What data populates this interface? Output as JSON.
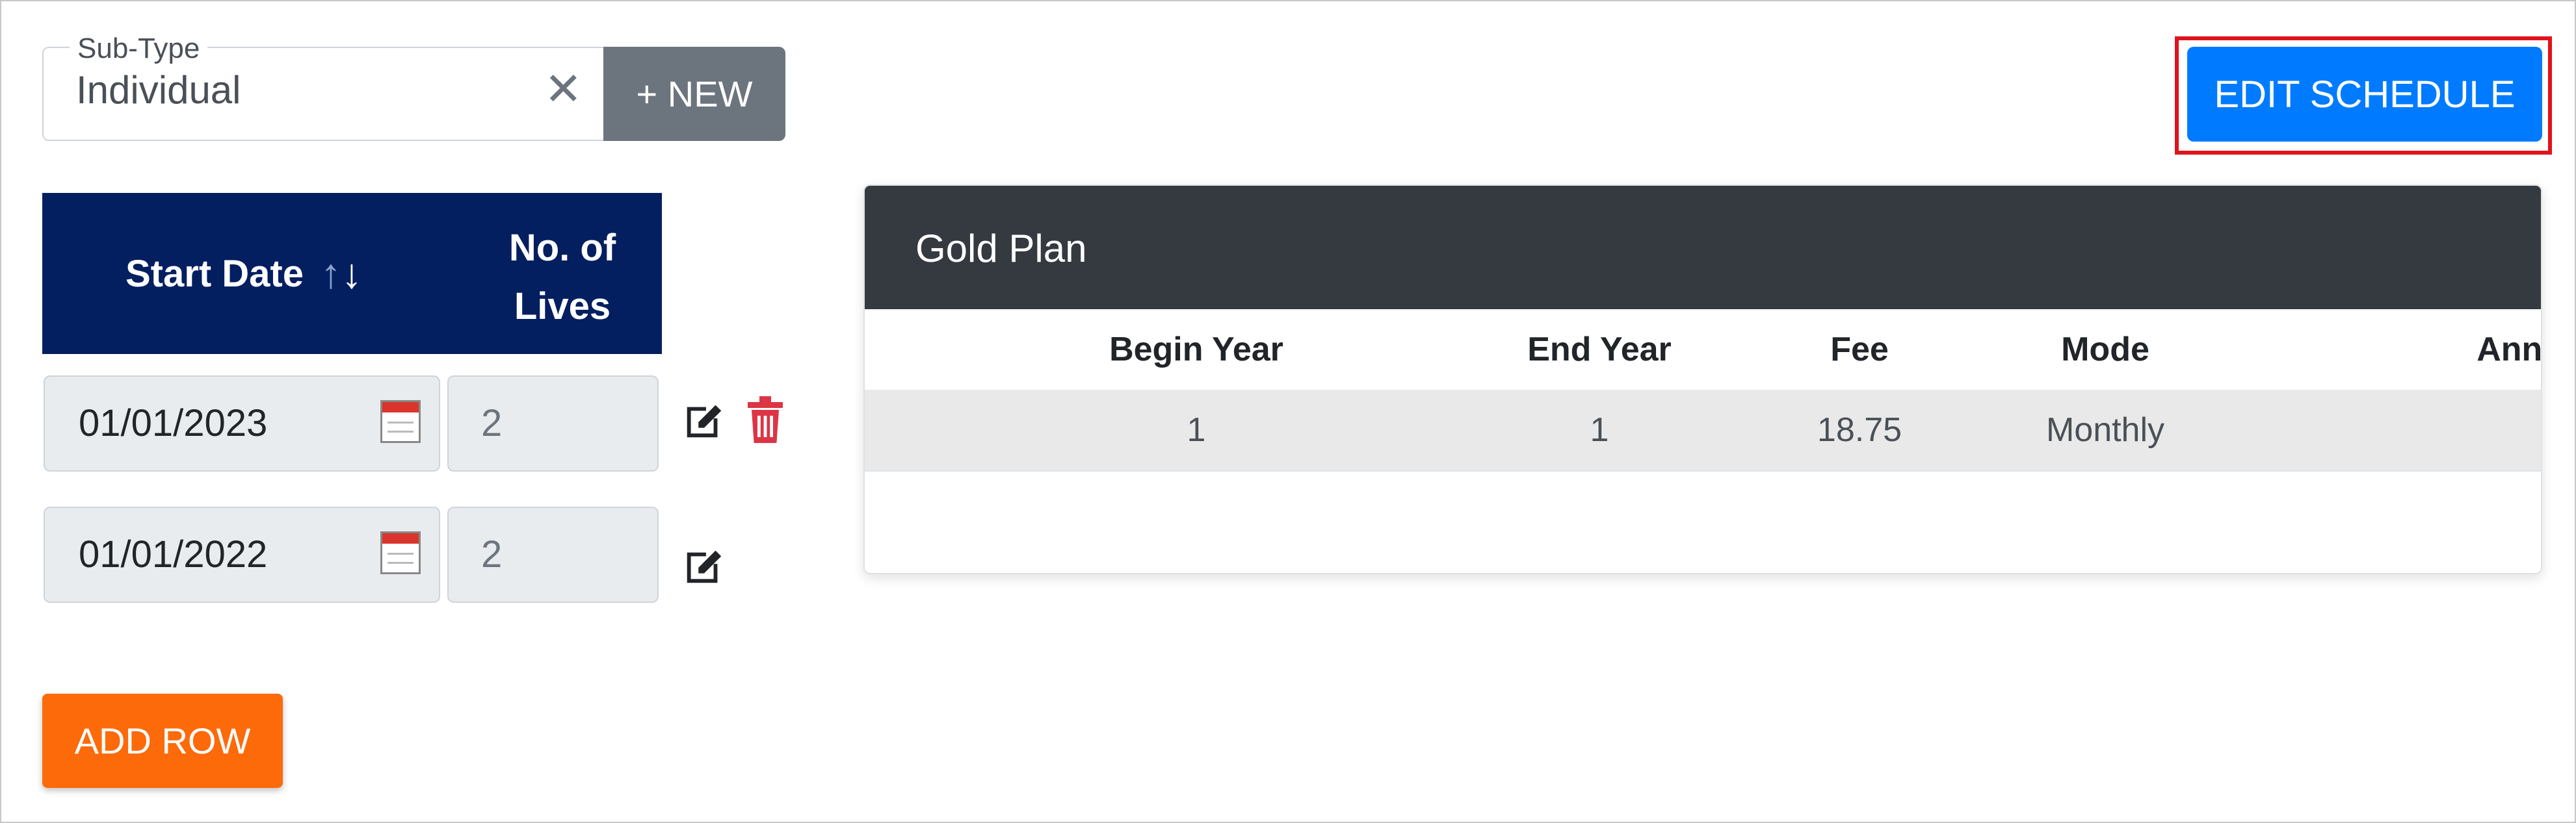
{
  "subtype": {
    "legend": "Sub-Type",
    "value": "Individual",
    "clear_glyph": "✕"
  },
  "new_button": "+ NEW",
  "edit_schedule_button": "EDIT SCHEDULE",
  "grid": {
    "headers": {
      "start_date": "Start Date",
      "sort_up": "↑",
      "sort_down": "↓",
      "lives_line1": "No. of",
      "lives_line2": "Lives"
    },
    "rows": [
      {
        "start_date": "01/01/2023",
        "lives": "2"
      },
      {
        "start_date": "01/01/2022",
        "lives": "2"
      }
    ]
  },
  "add_row_button": "ADD ROW",
  "plan": {
    "title": "Gold Plan",
    "columns": [
      "Begin Year",
      "End Year",
      "Fee",
      "Mode",
      "Annualization %"
    ],
    "rows": [
      {
        "begin_year": "1",
        "end_year": "1",
        "fee": "18.75",
        "mode": "Monthly",
        "annualization": ""
      }
    ]
  },
  "colors": {
    "header_navy": "#031f60",
    "primary_blue": "#007bff",
    "orange": "#fd6a0a",
    "delete_red": "#dc3545",
    "highlight_red": "#e0121b",
    "card_dark": "#343a40"
  }
}
